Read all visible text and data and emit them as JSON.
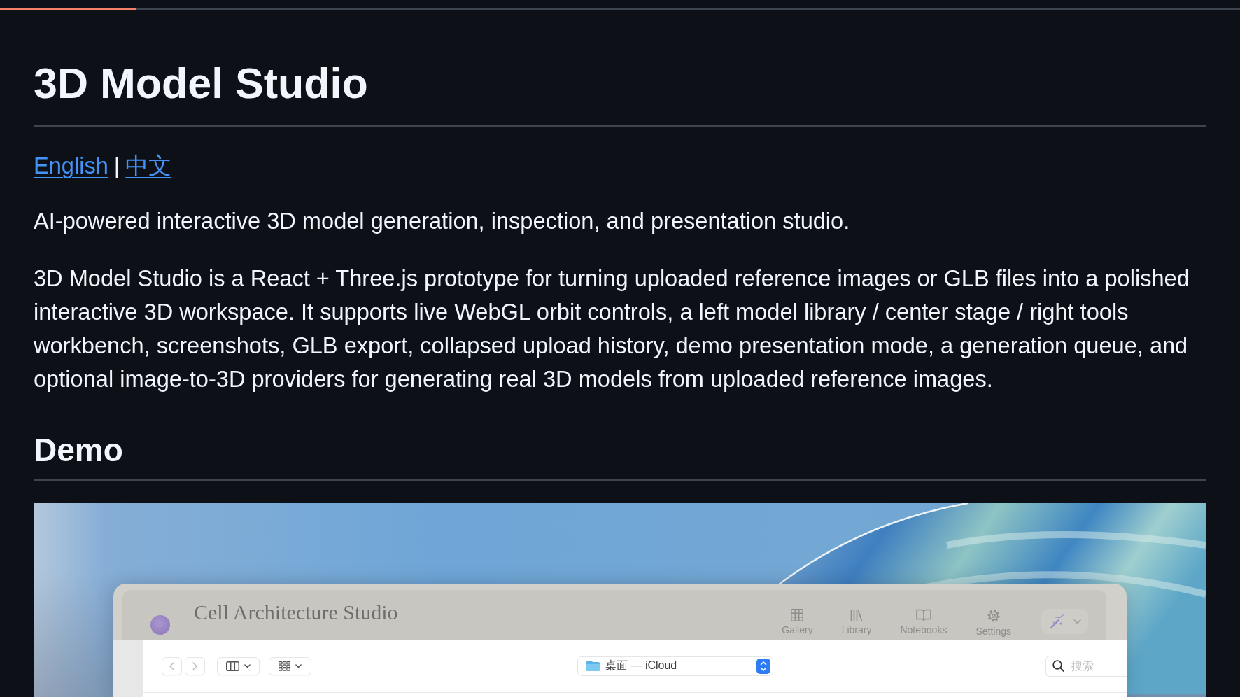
{
  "reading_progress": {
    "level": 0.11
  },
  "title": "3D Model Studio",
  "language_links": [
    {
      "label": "English"
    },
    {
      "label": "中文"
    }
  ],
  "link_separator": "|",
  "tagline": "AI-powered interactive 3D model generation, inspection, and presentation studio.",
  "description": "3D Model Studio is a React + Three.js prototype for turning uploaded reference images or GLB files into a polished interactive 3D workspace. It supports live WebGL orbit controls, a left model library / center stage / right tools workbench, screenshots, GLB export, collapsed upload history, demo presentation mode, a generation queue, and optional image-to-3D providers for generating real 3D models from uploaded reference images.",
  "demo": {
    "heading": "Demo",
    "screenshot": {
      "app_window": {
        "title": "Cell Architecture Studio",
        "toolbar": [
          {
            "label": "Gallery"
          },
          {
            "label": "Library"
          },
          {
            "label": "Notebooks"
          },
          {
            "label": "Settings"
          }
        ]
      },
      "file_dialog": {
        "location": "桌面 — iCloud",
        "search": {
          "placeholder": "搜索"
        }
      }
    }
  }
}
